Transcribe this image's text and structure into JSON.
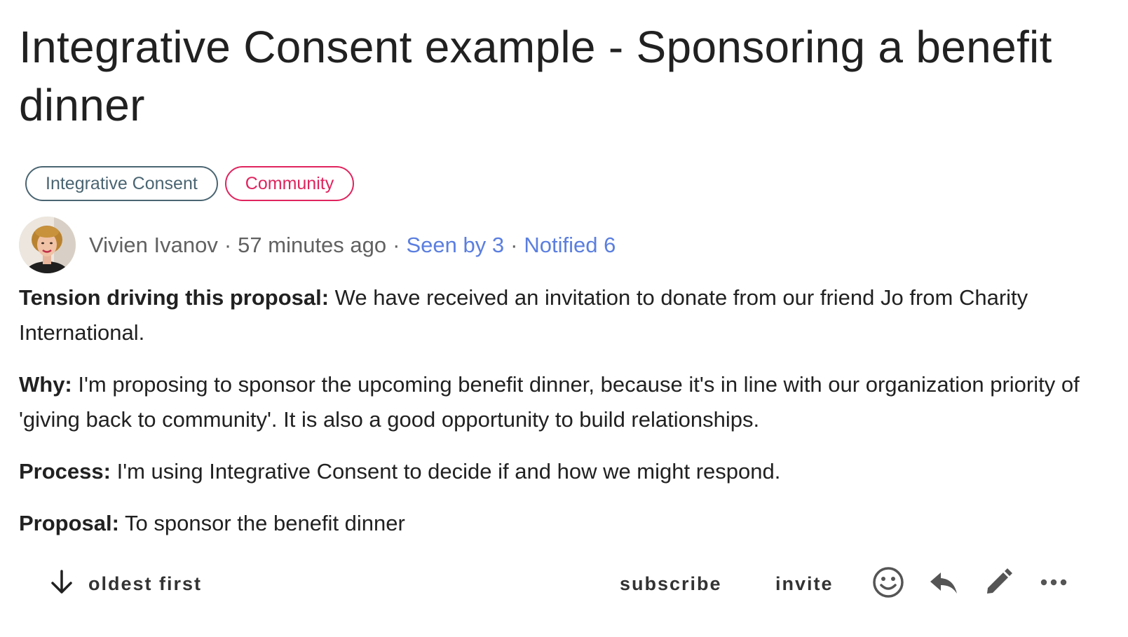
{
  "thread": {
    "title": "Integrative Consent example - Sponsoring a benefit dinner",
    "tags": [
      {
        "label": "Integrative Consent",
        "color": "#4a6572"
      },
      {
        "label": "Community",
        "color": "#e0245e"
      }
    ],
    "author": "Vivien Ivanov",
    "timestamp": "57 minutes ago",
    "seen_by": "Seen by 3",
    "notified": "Notified 6",
    "separator": "·"
  },
  "body": {
    "tension_label": "Tension driving this proposal:",
    "tension_text": " We have received an invitation to donate from our friend Jo from Charity International.",
    "why_label": "Why:",
    "why_text": " I'm proposing to sponsor the upcoming benefit dinner, because it's in line with our organization priority of 'giving back to community'. It is also a good opportunity to build relationships.",
    "process_label": "Process:",
    "process_text": " I'm using Integrative Consent to decide if and how we might respond.",
    "proposal_label": "Proposal:",
    "proposal_text": " To sponsor the benefit dinner"
  },
  "actions": {
    "sort_label": "oldest first",
    "subscribe_label": "subscribe",
    "invite_label": "invite",
    "icons": [
      "arrow-down-icon",
      "emoji-icon",
      "reply-icon",
      "edit-icon",
      "more-icon"
    ]
  },
  "colors": {
    "text": "#212121",
    "muted": "#616161",
    "link": "#5b7fe0",
    "tag_primary": "#4a6572",
    "tag_accent": "#e0245e"
  }
}
